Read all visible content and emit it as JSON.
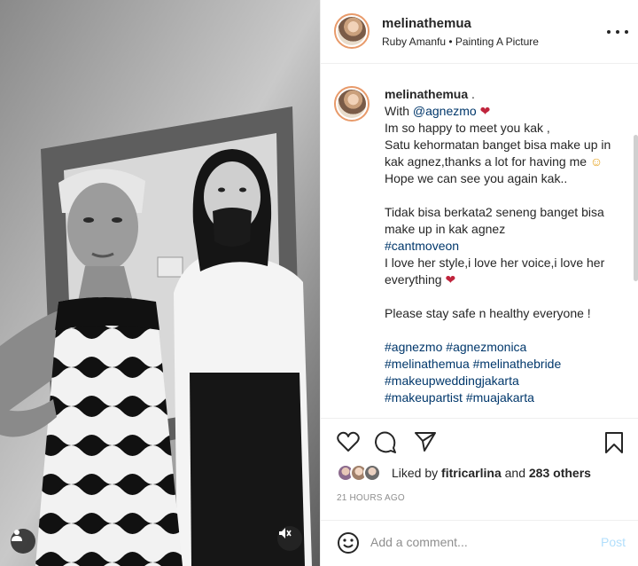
{
  "post": {
    "username": "melinathemua",
    "audio": "Ruby Amanfu • Painting A Picture",
    "more_icon": "more-horizontal-icon"
  },
  "caption": {
    "username": "melinathemua",
    "suffix": " .",
    "line_with": "With ",
    "mention": "@agnezmo",
    "heart_emoji": " ❤",
    "line2": "Im so happy to meet you kak ,",
    "line3": "Satu kehormatan banget bisa make up in kak agnez,thanks a lot for having me ",
    "smile_emoji": "☺",
    "line4": "Hope we can see you again kak..",
    "line5": "Tidak bisa berkata2 seneng banget bisa make up in kak agnez",
    "hashtag_cantmoveon": "#cantmoveon",
    "line6": "I love her style,i love her voice,i love her everything ",
    "heart_emoji2": "❤",
    "line7": "Please stay safe n healthy everyone !",
    "hashtags": [
      "#agnezmo",
      "#agnezmonica",
      "#melinathemua",
      "#melinathebride",
      "#makeupweddingjakarta",
      "#makeupartist",
      "#muajakarta"
    ]
  },
  "likes": {
    "prefix": "Liked by ",
    "user": "fitricarlina",
    "middle": " and ",
    "others": "283 others"
  },
  "timestamp": "21 HOURS AGO",
  "comment": {
    "placeholder": "Add a comment...",
    "post_label": "Post"
  },
  "colors": {
    "link": "#00376b",
    "post_disabled": "#b2dffc",
    "muted": "#8e8e8e"
  }
}
